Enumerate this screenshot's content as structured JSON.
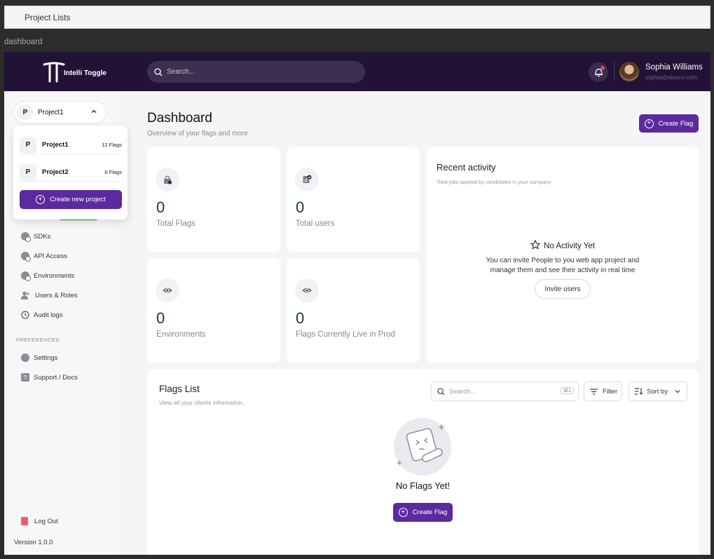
{
  "top_bar": {
    "title": "Project Lists"
  },
  "frame_label": "dashboard",
  "header": {
    "logo_text": "Intelli Toggle",
    "search_placeholder": "Search...",
    "user_name": "Sophia Williams",
    "user_email": "sophia@alsaxui.com"
  },
  "sidebar": {
    "current_project": "Project1",
    "project_badge": "P",
    "dropdown": {
      "projects": [
        {
          "badge": "P",
          "name": "Project1",
          "count": "12 Flags"
        },
        {
          "badge": "P",
          "name": "Project2",
          "count": "6 Flags"
        }
      ],
      "create_label": "Create new project"
    },
    "nav": [
      "SDKs",
      "API Access",
      "Environments",
      "Users & Roles",
      "Audit logs"
    ],
    "preferences_label": "PREFERENCES",
    "pref_nav": [
      "Settings",
      "Support / Docs"
    ],
    "logout_label": "Log Out",
    "version": "Version 1.0.0"
  },
  "main": {
    "title": "Dashboard",
    "subtitle": "Overview of your flags and more",
    "create_flag_label": "Create Flag",
    "stats": [
      {
        "value": "0",
        "label": "Total Flags",
        "icon": "lock-icon"
      },
      {
        "value": "0",
        "label": "Total users",
        "icon": "user-check-icon"
      },
      {
        "value": "0",
        "label": "Environments",
        "icon": "eye-icon"
      },
      {
        "value": "0",
        "label": "Flags Currently Live in Prod",
        "icon": "eye-icon"
      }
    ],
    "recent_activity": {
      "title": "Recent activity",
      "subtitle": "Total jobs applied by candidates in your company",
      "empty_title": "No Activity Yet",
      "empty_body_1": "You can invite People to you web app project and",
      "empty_body_2": "manage them and see their activity in real time",
      "invite_label": "Invite users"
    },
    "flags_list": {
      "title": "Flags List",
      "subtitle": "View all your clients information.",
      "search_placeholder": "Search...",
      "shortcut": "⌘1",
      "filter_label": "Filter",
      "sort_label": "Sort by",
      "empty_title": "No Flags Yet!",
      "create_label": "Create Flag"
    }
  },
  "colors": {
    "brand": "#5b2a9e",
    "header_bg": "#211236",
    "stat_value": "#173a35"
  }
}
